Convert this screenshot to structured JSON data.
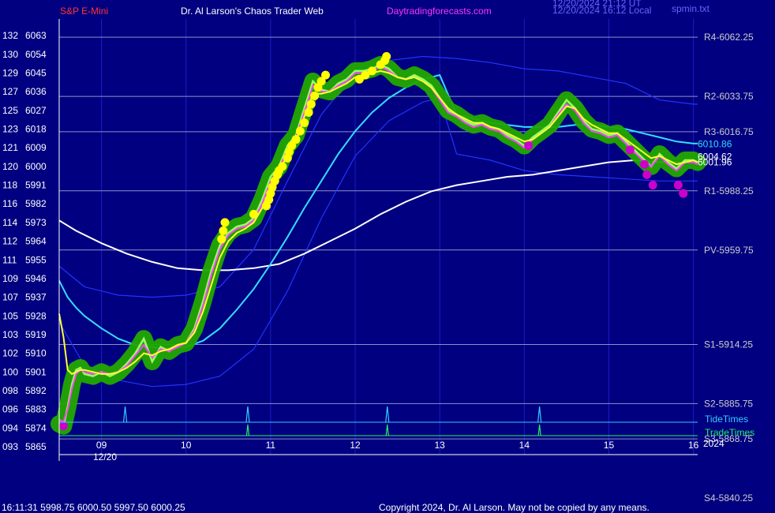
{
  "header": {
    "symbol": "S&P E-Mini",
    "site_title": "Dr. Al Larson's Chaos Trader Web",
    "site_url": "Daytradingforecasts.com",
    "stamp_line1": "12/20/2024 21:12 UT",
    "stamp_line2": "12/20/2024 16:12 Local",
    "chart_file": "spmin.txt"
  },
  "footer": {
    "last_quote": "16:11:31  5998.75 6000.50 5997.50 6000.25",
    "copyright": "Copyright 2024, Dr. Al Larson. May not be copied by any means."
  },
  "colors": {
    "background": "#000080",
    "grid": "#8f8fc8",
    "text": "#ffffff",
    "header_red": "#ff3333",
    "header_magenta": "#ff33ff",
    "cyan_ma": "#33ddff",
    "white_ma": "#ffffff",
    "blue_band": "#2233ff",
    "glow": "#22a800",
    "price": "#99ff66",
    "yellow_avg": "#ffff33",
    "magenta_avg": "#ff44ff",
    "yellow_dot": "#ffff00",
    "magenta_dot": "#cc00cc",
    "tide": "#33ccff",
    "trade": "#22ee66"
  },
  "chart_data": {
    "type": "line",
    "y_axis": {
      "ylim": [
        5865,
        6068
      ],
      "ticks": [
        {
          "num": "132",
          "price": 6063
        },
        {
          "num": "130",
          "price": 6054
        },
        {
          "num": "129",
          "price": 6045
        },
        {
          "num": "127",
          "price": 6036
        },
        {
          "num": "125",
          "price": 6027
        },
        {
          "num": "123",
          "price": 6018
        },
        {
          "num": "121",
          "price": 6009
        },
        {
          "num": "120",
          "price": 6000
        },
        {
          "num": "118",
          "price": 5991
        },
        {
          "num": "116",
          "price": 5982
        },
        {
          "num": "114",
          "price": 5973
        },
        {
          "num": "112",
          "price": 5964
        },
        {
          "num": "111",
          "price": 5955
        },
        {
          "num": "109",
          "price": 5946
        },
        {
          "num": "107",
          "price": 5937
        },
        {
          "num": "105",
          "price": 5928
        },
        {
          "num": "103",
          "price": 5919
        },
        {
          "num": "102",
          "price": 5910
        },
        {
          "num": "100",
          "price": 5901
        },
        {
          "num": "098",
          "price": 5892
        },
        {
          "num": "096",
          "price": 5883
        },
        {
          "num": "094",
          "price": 5874
        },
        {
          "num": "093",
          "price": 5865
        }
      ]
    },
    "x_axis": {
      "xlim": [
        8.5,
        16.05
      ],
      "hour_ticks": [
        9,
        10,
        11,
        12,
        13,
        14,
        15,
        16
      ],
      "hour_labels": [
        "09",
        "10",
        "11",
        "12",
        "13",
        "14",
        "15",
        "16"
      ],
      "date_label": "12/20",
      "year_label": "2024"
    },
    "pivot_levels": [
      {
        "label": "R4-6062.25",
        "value": 6062.25
      },
      {
        "label": "R2-6033.75",
        "value": 6033.75
      },
      {
        "label": "R3-6016.75",
        "value": 6016.75
      },
      {
        "label": "R1-5988.25",
        "value": 5988.25
      },
      {
        "label": "PV-5959.75",
        "value": 5959.75
      },
      {
        "label": "S1-5914.25",
        "value": 5914.25
      },
      {
        "label": "S2-5885.75",
        "value": 5885.75
      },
      {
        "label": "S3-5868.75",
        "value": 5868.75
      },
      {
        "label": "S4-5840.25",
        "value": 5840.25
      }
    ],
    "value_labels": [
      {
        "text": "6010.86",
        "value": 6010.86,
        "color": "#33ddff"
      },
      {
        "text": "6004.62",
        "value": 6004.62,
        "color": "#ffffff"
      },
      {
        "text": "6001.96",
        "value": 6001.96,
        "color": "#ffffff"
      }
    ],
    "tide_times": {
      "label": "TideTimes",
      "times": [
        9.28,
        10.73,
        12.38,
        14.18
      ]
    },
    "trade_times": {
      "label": "TradeTimes",
      "times": [
        10.73,
        12.38,
        14.18
      ]
    },
    "series": [
      {
        "role": "price",
        "x": [
          8.5,
          8.55,
          8.6,
          8.65,
          8.7,
          8.75,
          8.8,
          8.9,
          9.0,
          9.1,
          9.2,
          9.3,
          9.4,
          9.5,
          9.6,
          9.7,
          9.8,
          9.9,
          10.0,
          10.1,
          10.2,
          10.3,
          10.4,
          10.5,
          10.6,
          10.7,
          10.8,
          10.9,
          11.0,
          11.1,
          11.2,
          11.3,
          11.4,
          11.5,
          11.6,
          11.7,
          11.8,
          11.9,
          12.0,
          12.1,
          12.2,
          12.3,
          12.4,
          12.5,
          12.6,
          12.7,
          12.8,
          12.9,
          13.0,
          13.1,
          13.2,
          13.3,
          13.4,
          13.5,
          13.6,
          13.7,
          13.8,
          13.9,
          14.0,
          14.1,
          14.2,
          14.3,
          14.4,
          14.5,
          14.6,
          14.7,
          14.8,
          14.9,
          15.0,
          15.1,
          15.2,
          15.3,
          15.4,
          15.5,
          15.6,
          15.7,
          15.8,
          15.9,
          16.0,
          16.05
        ],
        "values": [
          5876,
          5875,
          5884,
          5895,
          5902,
          5903,
          5900,
          5899,
          5901,
          5899,
          5901,
          5905,
          5910,
          5917,
          5906,
          5913,
          5911,
          5914,
          5915,
          5922,
          5935,
          5950,
          5962,
          5968,
          5971,
          5972,
          5975,
          5984,
          5995,
          6000,
          6010,
          6015,
          6028,
          6041,
          6037,
          6036,
          6040,
          6042,
          6046,
          6046,
          6047,
          6049,
          6047,
          6043,
          6042,
          6044,
          6042,
          6039,
          6033,
          6027,
          6025,
          6022,
          6020,
          6021,
          6019,
          6018,
          6015,
          6013,
          6010,
          6014,
          6017,
          6020,
          6026,
          6032,
          6028,
          6022,
          6018,
          6017,
          6015,
          6016,
          6012,
          6008,
          6004,
          6000,
          6006,
          6002,
          5999,
          6003,
          6003,
          6002
        ]
      },
      {
        "role": "yellow-average",
        "x": [
          8.5,
          8.55,
          8.6,
          8.65,
          8.7,
          8.75,
          8.8,
          8.9,
          9.0,
          9.1,
          9.2,
          9.3,
          9.4,
          9.5,
          9.6,
          9.7,
          9.8,
          9.9,
          10.0,
          10.1,
          10.2,
          10.3,
          10.4,
          10.5,
          10.6,
          10.7,
          10.8,
          10.9,
          11.0,
          11.1,
          11.2,
          11.3,
          11.4,
          11.5,
          11.6,
          11.7,
          11.8,
          11.9,
          12.0,
          12.1,
          12.2,
          12.3,
          12.4,
          12.5,
          12.6,
          12.7,
          12.8,
          12.9,
          13.0,
          13.1,
          13.2,
          13.3,
          13.4,
          13.5,
          13.6,
          13.7,
          13.8,
          13.9,
          14.0,
          14.1,
          14.2,
          14.3,
          14.4,
          14.5,
          14.6,
          14.7,
          14.8,
          14.9,
          15.0,
          15.1,
          15.2,
          15.3,
          15.4,
          15.5,
          15.6,
          15.7,
          15.8,
          15.9,
          16.0,
          16.05
        ],
        "values": [
          5929,
          5918,
          5902,
          5900,
          5901,
          5902,
          5902,
          5901,
          5900,
          5900,
          5901,
          5903,
          5906,
          5910,
          5909,
          5911,
          5912,
          5914,
          5915,
          5920,
          5930,
          5943,
          5956,
          5964,
          5968,
          5970,
          5973,
          5980,
          5990,
          5997,
          6006,
          6012,
          6024,
          6035,
          6035,
          6036,
          6038,
          6040,
          6043,
          6044,
          6045,
          6046,
          6045,
          6043,
          6042,
          6043,
          6041,
          6038,
          6033,
          6028,
          6025,
          6023,
          6021,
          6021,
          6019,
          6018,
          6016,
          6014,
          6012,
          6013,
          6016,
          6019,
          6024,
          6029,
          6028,
          6023,
          6020,
          6018,
          6016,
          6016,
          6013,
          6010,
          6007,
          6004,
          6005,
          6003,
          6001,
          6002,
          6003,
          6002
        ]
      },
      {
        "role": "cyan-moving-average",
        "x": [
          8.5,
          8.6,
          8.7,
          8.8,
          9.0,
          9.2,
          9.4,
          9.6,
          9.8,
          10.0,
          10.2,
          10.4,
          10.6,
          10.8,
          11.0,
          11.2,
          11.4,
          11.6,
          11.8,
          12.0,
          12.2,
          12.4,
          12.6,
          12.8,
          13.0,
          13.2,
          13.4,
          13.6,
          13.8,
          14.0,
          14.2,
          14.4,
          14.6,
          14.8,
          15.0,
          15.2,
          15.4,
          15.6,
          15.8,
          16.0,
          16.05
        ],
        "values": [
          5945,
          5937,
          5932,
          5928,
          5922,
          5917,
          5914,
          5913,
          5912,
          5913,
          5916,
          5922,
          5931,
          5941,
          5953,
          5966,
          5980,
          5993,
          6006,
          6017,
          6026,
          6033,
          6038,
          6042,
          6044,
          6025,
          6023,
          6021,
          6020,
          6019,
          6019,
          6019,
          6020,
          6020,
          6019,
          6018,
          6016,
          6014,
          6012,
          6011,
          6011
        ]
      },
      {
        "role": "white-moving-average",
        "x": [
          8.5,
          8.7,
          9.0,
          9.3,
          9.6,
          9.9,
          10.2,
          10.5,
          10.8,
          11.1,
          11.4,
          11.7,
          12.0,
          12.3,
          12.6,
          12.9,
          13.2,
          13.5,
          13.8,
          14.1,
          14.4,
          14.7,
          15.0,
          15.3,
          15.6,
          15.9,
          16.05
        ],
        "values": [
          5974,
          5969,
          5963,
          5958,
          5954,
          5951,
          5950,
          5950,
          5951,
          5953,
          5958,
          5964,
          5970,
          5977,
          5983,
          5988,
          5991,
          5993,
          5995,
          5996,
          5998,
          6000,
          6002,
          6003,
          6002,
          6002,
          6002
        ]
      },
      {
        "role": "blue-upper-band",
        "x": [
          8.5,
          8.8,
          9.2,
          9.6,
          10.0,
          10.4,
          10.8,
          11.2,
          11.6,
          12.0,
          12.4,
          12.8,
          13.2,
          13.6,
          14.0,
          14.4,
          14.8,
          15.2,
          15.6,
          16.0,
          16.05
        ],
        "values": [
          5952,
          5942,
          5938,
          5937,
          5938,
          5942,
          5960,
          5993,
          6025,
          6045,
          6051,
          6053,
          6052,
          6050,
          6047,
          6046,
          6043,
          6040,
          6032,
          6030,
          6030
        ]
      },
      {
        "role": "blue-lower-band",
        "x": [
          8.5,
          8.8,
          9.2,
          9.6,
          10.0,
          10.4,
          10.8,
          11.2,
          11.6,
          12.0,
          12.4,
          12.8,
          13.0,
          13.2,
          13.6,
          14.0,
          14.4,
          14.8,
          15.2,
          15.6,
          16.0,
          16.05
        ],
        "values": [
          5925,
          5904,
          5897,
          5894,
          5895,
          5899,
          5912,
          5940,
          5975,
          6005,
          6022,
          6031,
          6033,
          6006,
          6003,
          5998,
          5996,
          5995,
          5994,
          5993,
          5993,
          5993
        ]
      },
      {
        "role": "magenta-average",
        "x": [
          8.5,
          8.55,
          8.6,
          8.65,
          8.7,
          8.75,
          8.8,
          8.9,
          9.0,
          9.1,
          9.2,
          9.3,
          9.4,
          9.5,
          9.6,
          9.7,
          9.8,
          9.9,
          10.0,
          10.1,
          10.2,
          10.3,
          10.4,
          10.5,
          10.6,
          10.7,
          10.8,
          10.9,
          11.0,
          11.1,
          11.2,
          11.3,
          11.4,
          11.5,
          11.6,
          11.7,
          11.8,
          11.9,
          12.0,
          12.1,
          12.2,
          12.3,
          12.4,
          12.5,
          12.6,
          12.7,
          12.8,
          12.9,
          13.0,
          13.1,
          13.2,
          13.3,
          13.4,
          13.5,
          13.6,
          13.7,
          13.8,
          13.9,
          14.0,
          14.1,
          14.2,
          14.3,
          14.4,
          14.5,
          14.6,
          14.7,
          14.8,
          14.9,
          15.0,
          15.1,
          15.2,
          15.3,
          15.4,
          15.5,
          15.6,
          15.7,
          15.8,
          15.9,
          16.0,
          16.05
        ],
        "values": [
          5878,
          5877,
          5883,
          5893,
          5900,
          5902,
          5901,
          5900,
          5901,
          5900,
          5901,
          5904,
          5909,
          5914,
          5908,
          5912,
          5911,
          5913,
          5915,
          5921,
          5933,
          5948,
          5960,
          5967,
          5970,
          5971,
          5974,
          5982,
          5993,
          5999,
          6008,
          6014,
          6026,
          6039,
          6036,
          6036,
          6039,
          6041,
          6045,
          6045,
          6046,
          6048,
          6046,
          6043,
          6042,
          6043,
          6041,
          6038,
          6032,
          6026,
          6024,
          6021,
          6019,
          6020,
          6018,
          6017,
          6014,
          6012,
          6009,
          6013,
          6016,
          6019,
          6025,
          6030,
          6027,
          6021,
          6017,
          6016,
          6014,
          6015,
          6011,
          6007,
          6003,
          6000,
          6005,
          6001,
          5998,
          6002,
          6002,
          6001
        ]
      }
    ],
    "yellow_markers": [
      {
        "x": 10.42,
        "value": 5965
      },
      {
        "x": 10.44,
        "value": 5969
      },
      {
        "x": 10.46,
        "value": 5973
      },
      {
        "x": 10.8,
        "value": 5977
      },
      {
        "x": 10.95,
        "value": 5981
      },
      {
        "x": 10.98,
        "value": 5984
      },
      {
        "x": 11.0,
        "value": 5987
      },
      {
        "x": 11.02,
        "value": 5990
      },
      {
        "x": 11.05,
        "value": 5993
      },
      {
        "x": 11.08,
        "value": 5996
      },
      {
        "x": 11.1,
        "value": 5998
      },
      {
        "x": 11.14,
        "value": 6000
      },
      {
        "x": 11.2,
        "value": 6004
      },
      {
        "x": 11.22,
        "value": 6007
      },
      {
        "x": 11.25,
        "value": 6010
      },
      {
        "x": 11.3,
        "value": 6013
      },
      {
        "x": 11.35,
        "value": 6017
      },
      {
        "x": 11.4,
        "value": 6021
      },
      {
        "x": 11.45,
        "value": 6026
      },
      {
        "x": 11.48,
        "value": 6030
      },
      {
        "x": 11.52,
        "value": 6034
      },
      {
        "x": 11.56,
        "value": 6038
      },
      {
        "x": 11.6,
        "value": 6041
      },
      {
        "x": 11.65,
        "value": 6044
      },
      {
        "x": 12.05,
        "value": 6042
      },
      {
        "x": 12.12,
        "value": 6044
      },
      {
        "x": 12.2,
        "value": 6046
      },
      {
        "x": 12.3,
        "value": 6049
      },
      {
        "x": 12.35,
        "value": 6051
      },
      {
        "x": 12.37,
        "value": 6053
      }
    ],
    "magenta_markers": [
      {
        "x": 8.55,
        "value": 5875
      },
      {
        "x": 14.05,
        "value": 6010
      },
      {
        "x": 15.25,
        "value": 6008
      },
      {
        "x": 15.42,
        "value": 6001
      },
      {
        "x": 15.45,
        "value": 5996
      },
      {
        "x": 15.52,
        "value": 5991
      },
      {
        "x": 15.82,
        "value": 5991
      },
      {
        "x": 15.88,
        "value": 5987
      }
    ]
  }
}
